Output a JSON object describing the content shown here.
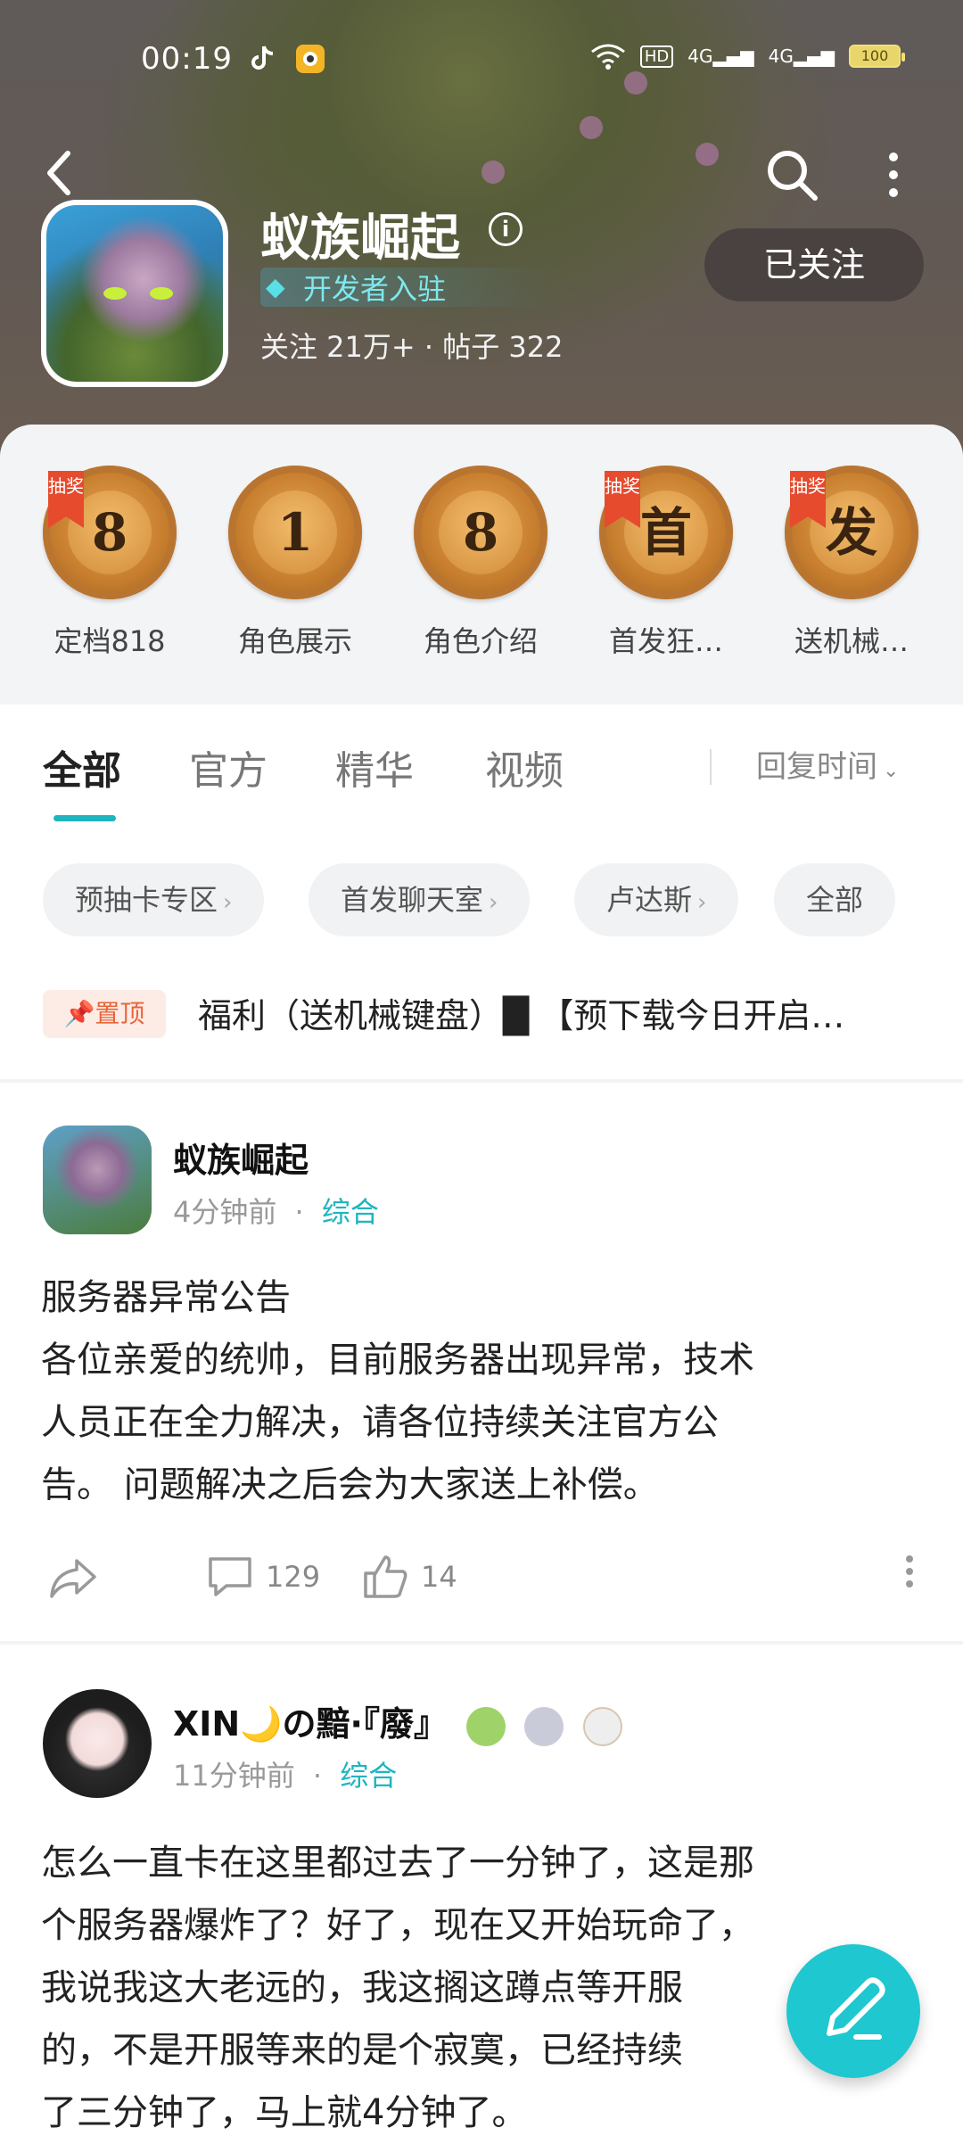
{
  "status_bar": {
    "time": "00:19",
    "battery": "100",
    "network_1": "4G",
    "network_2": "4G",
    "hd": "HD"
  },
  "header": {
    "title": "蚁族崛起",
    "developer_badge": "开发者入驻",
    "stats": "关注 21万+ · 帖子 322",
    "follow_button": "已关注"
  },
  "topics": [
    {
      "number": "8",
      "label": "定档818",
      "ribbon": "抽奖",
      "has_ribbon": true
    },
    {
      "number": "1",
      "label": "角色展示",
      "ribbon": "",
      "has_ribbon": false
    },
    {
      "number": "8",
      "label": "角色介绍",
      "ribbon": "",
      "has_ribbon": false
    },
    {
      "number": "首",
      "label": "首发狂…",
      "ribbon": "抽奖",
      "has_ribbon": true
    },
    {
      "number": "发",
      "label": "送机械…",
      "ribbon": "抽奖",
      "has_ribbon": true
    }
  ],
  "tabs": {
    "all": "全部",
    "official": "官方",
    "featured": "精华",
    "video": "视频",
    "sort": "回复时间"
  },
  "chips": [
    "预抽卡专区",
    "首发聊天室",
    "卢达斯",
    "全部"
  ],
  "pinned": {
    "badge": "置顶",
    "text": "福利（送机械键盘）█ 【预下载今日开启…"
  },
  "posts": [
    {
      "author": "蚁族崛起",
      "time": "4分钟前",
      "sep": "·",
      "category": "综合",
      "body_lines": [
        "服务器异常公告",
        "各位亲爱的统帅，目前服务器出现异常，技术",
        "人员正在全力解决，请各位持续关注官方公",
        "告。 问题解决之后会为大家送上补偿。"
      ],
      "comments": "129",
      "likes": "14"
    },
    {
      "author": "XIN🌙の黯·『廢』",
      "time": "11分钟前",
      "sep": "·",
      "category": "综合",
      "body_lines": [
        "怎么一直卡在这里都过去了一分钟了，这是那",
        "个服务器爆炸了？好了，现在又开始玩命了，",
        "我说我这大老远的，我这搁这蹲点等开服",
        "的，不是开服等来的是个寂寞，已经持续",
        "了三分钟了，马上就4分钟了。"
      ]
    }
  ],
  "colors": {
    "accent": "#1fb5bf",
    "pin": "#e8653a",
    "follow_bg": "#4a4240"
  },
  "icons": [
    "back-icon",
    "search-icon",
    "more-icon",
    "info-icon",
    "diamond-icon",
    "share-icon",
    "comment-icon",
    "like-icon",
    "edit-icon"
  ]
}
